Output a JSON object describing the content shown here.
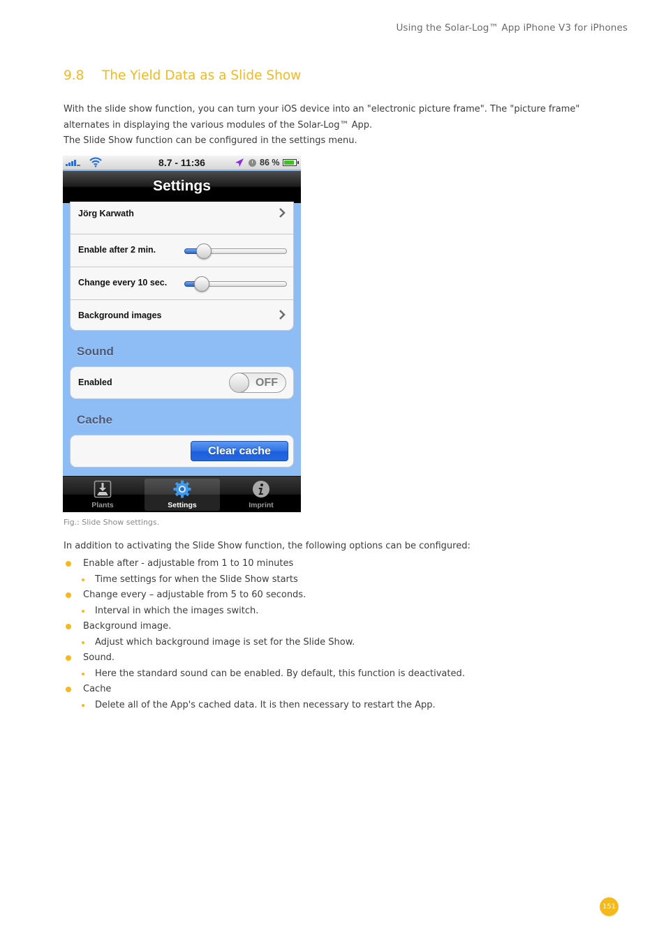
{
  "running_header": "Using the Solar-Log™ App iPhone V3 for iPhones",
  "section": {
    "number": "9.8",
    "title": "The Yield Data as a Slide Show"
  },
  "intro_paragraphs": [
    "With the slide show function, you can turn your iOS device into an \"electronic picture frame\". The \"picture frame\" alternates in displaying the various modules of the Solar-Log™ App.",
    "The Slide Show function can be configured in the settings menu."
  ],
  "phone": {
    "status_bar": {
      "time": "8.7 - 11:36",
      "battery_percent_text": "86 %",
      "battery_level": 0.86,
      "icons": [
        "signal-icon",
        "wifi-icon",
        "location-arrow-icon",
        "alarm-clock-icon",
        "battery-icon"
      ]
    },
    "nav_title": "Settings",
    "settings_rows": [
      {
        "label": "Jörg Karwath",
        "type": "disclosure"
      },
      {
        "label": "Enable after 2 min.",
        "type": "slider",
        "value": 2,
        "min": 1,
        "max": 10
      },
      {
        "label": "Change every 10 sec.",
        "type": "slider",
        "value": 10,
        "min": 5,
        "max": 60
      },
      {
        "label": "Background images",
        "type": "disclosure"
      }
    ],
    "sound": {
      "header": "Sound",
      "row_label": "Enabled",
      "toggle_state": "OFF"
    },
    "cache": {
      "header": "Cache",
      "button_label": "Clear cache"
    },
    "tabs": [
      {
        "label": "Plants",
        "icon": "download-icon",
        "active": false
      },
      {
        "label": "Settings",
        "icon": "gear-icon",
        "active": true
      },
      {
        "label": "Imprint",
        "icon": "info-icon",
        "active": false
      }
    ]
  },
  "caption": "Fig.: Slide Show settings.",
  "lead": "In addition to activating the Slide Show function, the following options can be configured:",
  "bullets": [
    {
      "text": "Enable after - adjustable from 1 to 10 minutes",
      "sub": "Time settings for when the Slide Show starts"
    },
    {
      "text": "Change every – adjustable from 5 to 60 seconds.",
      "sub": "Interval in which the images switch."
    },
    {
      "text": "Background image.",
      "sub": "Adjust which background image is set for the Slide Show."
    },
    {
      "text": "Sound.",
      "sub": "Here the standard sound can be enabled. By default, this function is deactivated."
    },
    {
      "text": "Cache",
      "sub": "Delete all of the App's cached data. It is then necessary to restart the App."
    }
  ],
  "page_number": "151",
  "colors": {
    "accent": "#f5b91d",
    "app_background": "#8ebdf5",
    "ios_button_blue": "#2f72e6"
  }
}
